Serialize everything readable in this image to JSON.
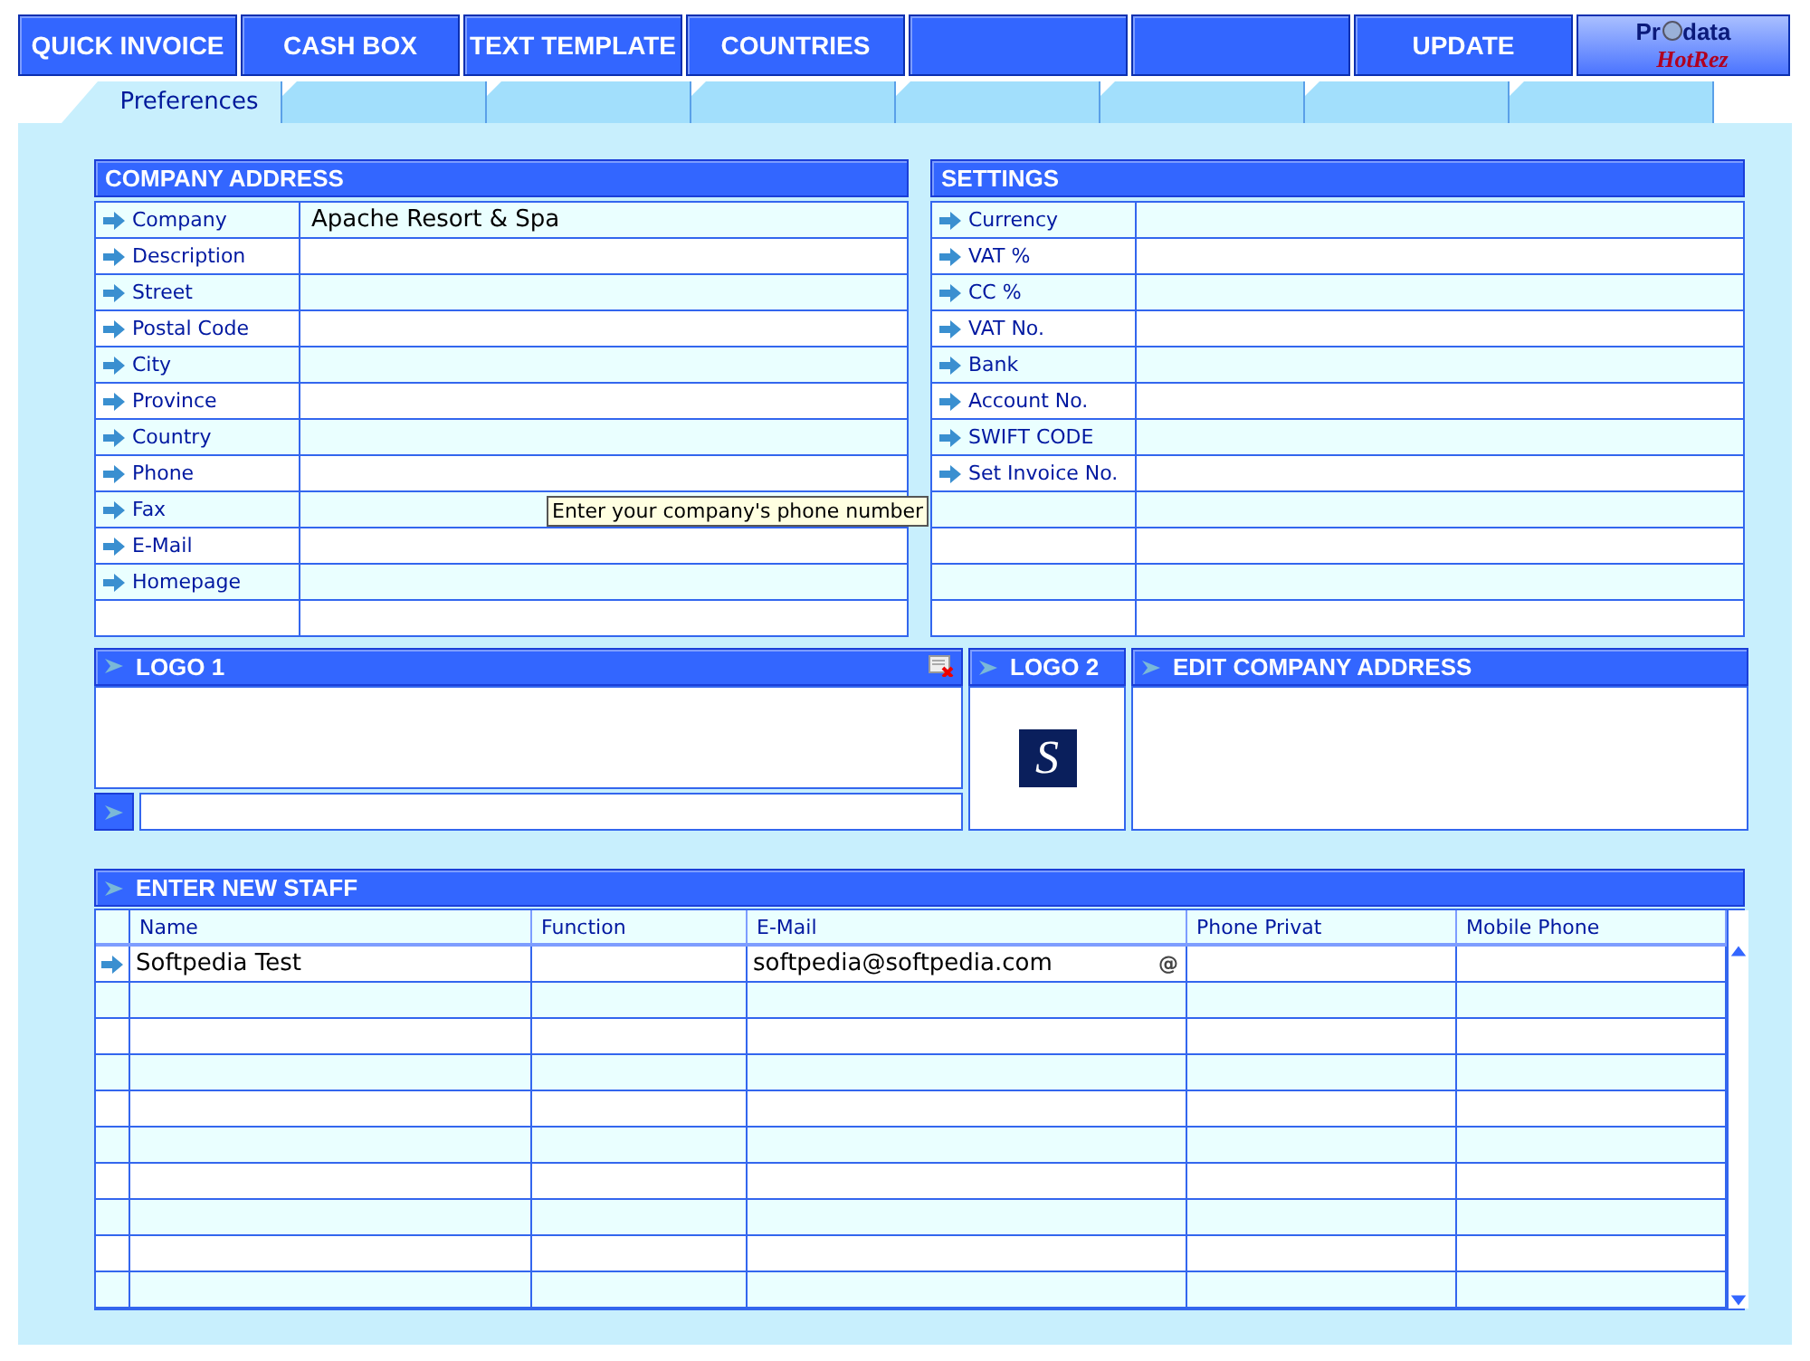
{
  "menu": {
    "left": [
      {
        "label": "QUICK INVOICE"
      },
      {
        "label": "CASH BOX"
      },
      {
        "label": "TEXT TEMPLATE"
      },
      {
        "label": "COUNTRIES"
      }
    ],
    "right": [
      {
        "label": "UPDATE"
      }
    ]
  },
  "brand": {
    "top_left": "Pr",
    "top_right": "data",
    "bottom": "HotRez"
  },
  "tabs": [
    {
      "label": "Preferences",
      "selected": true
    },
    {
      "selected": false
    },
    {
      "selected": false
    },
    {
      "selected": false
    },
    {
      "selected": false
    },
    {
      "selected": false
    },
    {
      "selected": false
    },
    {
      "selected": false
    }
  ],
  "company_address": {
    "title": "COMPANY ADDRESS",
    "fields": [
      {
        "label": "Company",
        "value": "Apache Resort & Spa"
      },
      {
        "label": "Description"
      },
      {
        "label": "Street"
      },
      {
        "label": "Postal Code"
      },
      {
        "label": "City"
      },
      {
        "label": "Province"
      },
      {
        "label": "Country"
      },
      {
        "label": "Phone"
      },
      {
        "label": "Fax"
      },
      {
        "label": "E-Mail"
      },
      {
        "label": "Homepage"
      }
    ]
  },
  "tooltip": "Enter your company's phone number",
  "settings": {
    "title": "SETTINGS",
    "fields": [
      {
        "label": "Currency"
      },
      {
        "label": "VAT %"
      },
      {
        "label": "CC %"
      },
      {
        "label": "VAT No."
      },
      {
        "label": "Bank"
      },
      {
        "label": "Account No."
      },
      {
        "label": "SWIFT CODE"
      },
      {
        "label": "Set Invoice No."
      }
    ]
  },
  "logo1": {
    "title": "LOGO 1"
  },
  "logo2": {
    "title": "LOGO 2",
    "mark": "S"
  },
  "edit_address": {
    "title": "EDIT COMPANY ADDRESS"
  },
  "staff": {
    "title": "ENTER NEW STAFF",
    "columns": [
      "Name",
      "Function",
      "E-Mail",
      "Phone Privat",
      "Mobile Phone"
    ],
    "rows": [
      {
        "name": "Softpedia Test",
        "email": "softpedia@softpedia.com",
        "email_mark": "@"
      }
    ]
  }
}
